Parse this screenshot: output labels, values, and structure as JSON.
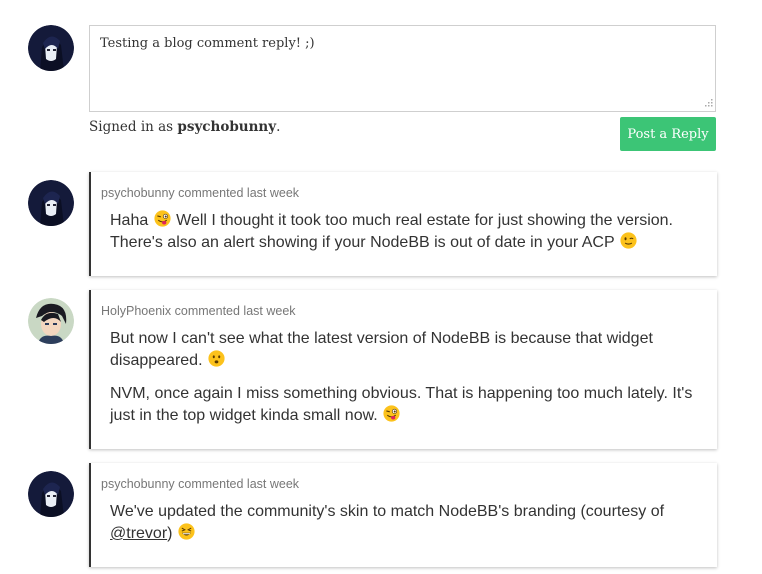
{
  "reply_form": {
    "text": "Testing a blog comment reply! ;)",
    "signed_in_prefix": "Signed in as ",
    "username": "psychobunny",
    "signed_in_suffix": ".",
    "button_label": "Post a Reply",
    "button_color": "#3cc576"
  },
  "comments": [
    {
      "author": "psychobunny",
      "meta": "psychobunny commented last week",
      "paragraphs": [
        {
          "before": "Haha ",
          "after": " Well I thought it took too much real estate for just showing the version. There's also an alert showing if your NodeBB is out of date in your ACP ",
          "tail": ""
        }
      ],
      "emojis": [
        "stuck-out-tongue-winking-eye",
        "wink"
      ]
    },
    {
      "author": "HolyPhoenix",
      "meta": "HolyPhoenix commented last week",
      "paragraphs": [
        {
          "text": "But now I can't see what the latest version of NodeBB is because that widget disappeared. "
        },
        {
          "text": "NVM, once again I miss something obvious. That is happening too much lately. It's just in the top widget kinda small now. "
        }
      ],
      "emojis": [
        "frowning",
        "stuck-out-tongue-winking-eye"
      ]
    },
    {
      "author": "psychobunny",
      "meta": "psychobunny commented last week",
      "paragraphs": [
        {
          "before": "We've updated the community's skin to match NodeBB's branding (courtesy of ",
          "mention": "@trevor",
          "after": ") "
        }
      ],
      "emojis": [
        "grinning-squinting"
      ]
    }
  ]
}
